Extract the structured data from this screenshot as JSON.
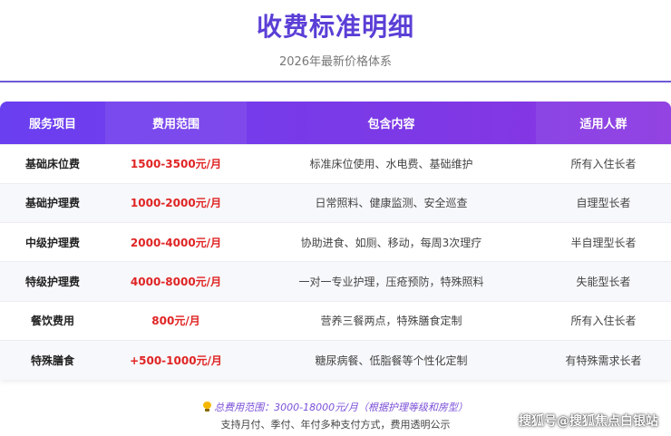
{
  "header": {
    "title": "收费标准明细",
    "subtitle": "2026年最新价格体系"
  },
  "table": {
    "columns": [
      "服务项目",
      "费用范围",
      "包含内容",
      "适用人群"
    ],
    "rows": [
      {
        "service": "基础床位费",
        "fee": "1500-3500元/月",
        "content": "标准床位使用、水电费、基础维护",
        "target": "所有入住长者"
      },
      {
        "service": "基础护理费",
        "fee": "1000-2000元/月",
        "content": "日常照料、健康监测、安全巡查",
        "target": "自理型长者"
      },
      {
        "service": "中级护理费",
        "fee": "2000-4000元/月",
        "content": "协助进食、如厕、移动，每周3次理疗",
        "target": "半自理型长者"
      },
      {
        "service": "特级护理费",
        "fee": "4000-8000元/月",
        "content": "一对一专业护理，压疮预防，特殊照料",
        "target": "失能型长者"
      },
      {
        "service": "餐饮费用",
        "fee": "800元/月",
        "content": "营养三餐两点，特殊膳食定制",
        "target": "所有入住长者"
      },
      {
        "service": "特殊膳食",
        "fee": "+500-1000元/月",
        "content": "糖尿病餐、低脂餐等个性化定制",
        "target": "有特殊需求长者"
      }
    ]
  },
  "footer": {
    "note_icon": "lightbulb-icon",
    "note": "总费用范围：3000-18000元/月（根据护理等级和房型）",
    "payment": "支持月付、季付、年付多种支付方式，费用透明公示"
  },
  "watermark": "搜狐号@搜狐焦点白银站",
  "colors": {
    "title": "#5b3fd6",
    "header_gradient_start": "#6a3ff0",
    "header_gradient_end": "#8a35e0",
    "fee": "#e02424",
    "note": "#7a4fd8"
  }
}
